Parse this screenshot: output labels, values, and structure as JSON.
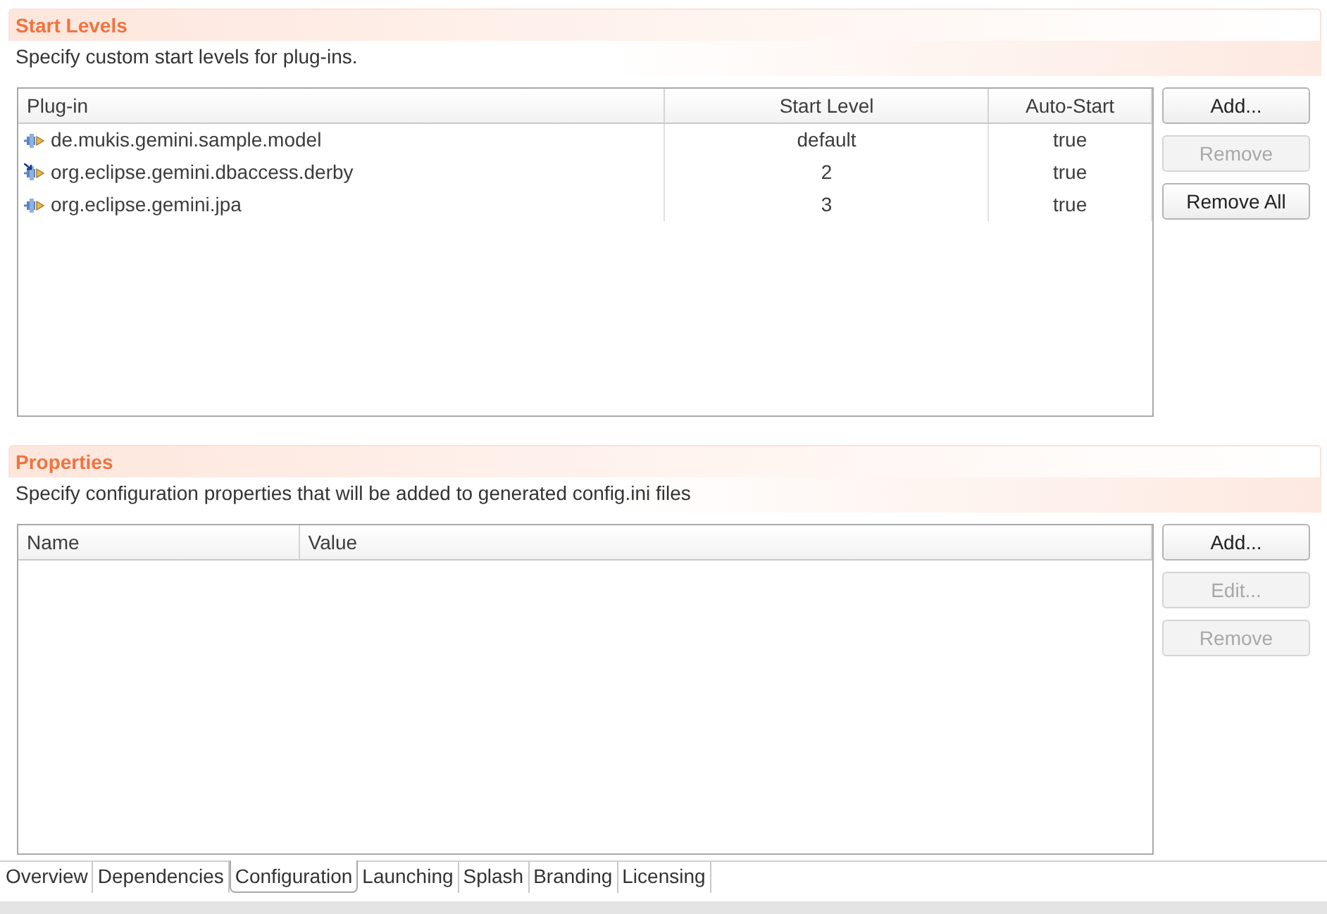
{
  "sections": [
    {
      "title": "Start Levels",
      "description": "Specify custom start levels for plug-ins.",
      "table": {
        "columns": [
          "Plug-in",
          "Start Level",
          "Auto-Start"
        ],
        "rows": [
          {
            "overlay": false,
            "cells": [
              "de.mukis.gemini.sample.model",
              "default",
              "true"
            ]
          },
          {
            "overlay": true,
            "cells": [
              "org.eclipse.gemini.dbaccess.derby",
              "2",
              "true"
            ]
          },
          {
            "overlay": false,
            "cells": [
              "org.eclipse.gemini.jpa",
              "3",
              "true"
            ]
          }
        ]
      },
      "buttons": [
        {
          "label": "Add...",
          "disabled": false
        },
        {
          "label": "Remove",
          "disabled": true
        },
        {
          "label": "Remove All",
          "disabled": false
        }
      ]
    },
    {
      "title": "Properties",
      "description": "Specify configuration properties that will be added to generated config.ini files",
      "table": {
        "columns": [
          "Name",
          "Value"
        ]
      },
      "buttons": [
        {
          "label": "Add...",
          "disabled": false
        },
        {
          "label": "Edit...",
          "disabled": true
        },
        {
          "label": "Remove",
          "disabled": true
        }
      ]
    }
  ],
  "tabs": [
    {
      "label": "Overview",
      "selected": false
    },
    {
      "label": "Dependencies",
      "selected": false
    },
    {
      "label": "Configuration",
      "selected": true
    },
    {
      "label": "Launching",
      "selected": false
    },
    {
      "label": "Splash",
      "selected": false
    },
    {
      "label": "Branding",
      "selected": false
    },
    {
      "label": "Licensing",
      "selected": false
    }
  ]
}
